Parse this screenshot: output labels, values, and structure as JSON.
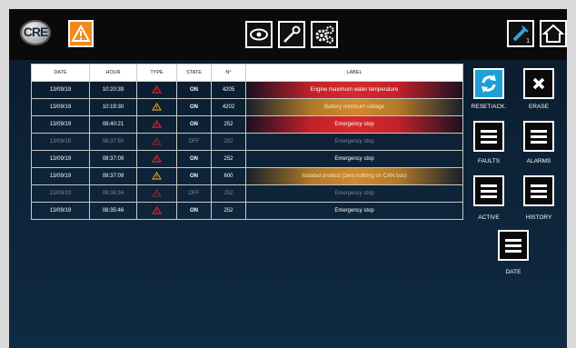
{
  "header": {
    "logo_text": "CRE",
    "colors": {
      "accent": "#f08a1e",
      "reset_accent": "#1ea0d4"
    }
  },
  "table": {
    "headers": [
      "DATE",
      "HOUR",
      "TYPE",
      "STATE",
      "N°",
      "LABEL"
    ],
    "rows": [
      {
        "date": "13/09/19",
        "hour": "10:20:39",
        "type": "red-warning-icon",
        "state": "ON",
        "num": "4205",
        "label": "Engine maximum water temperature",
        "style": "red",
        "active": true
      },
      {
        "date": "13/09/19",
        "hour": "10:19:30",
        "type": "orange-warning-icon",
        "state": "ON",
        "num": "4202",
        "label": "Battery minimum voltage",
        "style": "orange",
        "active": true
      },
      {
        "date": "13/09/19",
        "hour": "08:40:21",
        "type": "red-warning-icon",
        "state": "ON",
        "num": "252",
        "label": "Emergency stop",
        "style": "red",
        "active": true
      },
      {
        "date": "13/09/19",
        "hour": "08:37:50",
        "type": "red-warning-icon",
        "state": "OFF",
        "num": "252",
        "label": "Emergency stop",
        "style": "none",
        "active": false
      },
      {
        "date": "13/09/19",
        "hour": "08:37:09",
        "type": "red-warning-icon",
        "state": "ON",
        "num": "252",
        "label": "Emergency stop",
        "style": "none",
        "active": true
      },
      {
        "date": "13/09/19",
        "hour": "08:37:09",
        "type": "orange-warning-icon",
        "state": "ON",
        "num": "600",
        "label": "Isolated product (zero nothing on CAN bus)",
        "style": "orange",
        "active": true
      },
      {
        "date": "13/09/19",
        "hour": "08:36:34",
        "type": "red-warning-icon",
        "state": "OFF",
        "num": "252",
        "label": "Emergency stop",
        "style": "none",
        "active": false
      },
      {
        "date": "13/09/19",
        "hour": "08:35:46",
        "type": "red-warning-icon",
        "state": "ON",
        "num": "252",
        "label": "Emergency stop",
        "style": "none",
        "active": true
      }
    ]
  },
  "side": {
    "reset_label": "RESET/ACK.",
    "erase_label": "ERASE",
    "faults_label": "FAULTS",
    "alarms_label": "ALARMS",
    "active_label": "ACTIVE",
    "history_label": "HISTORY",
    "date_label": "DATE"
  },
  "topbar": {
    "badge_count": "1"
  }
}
